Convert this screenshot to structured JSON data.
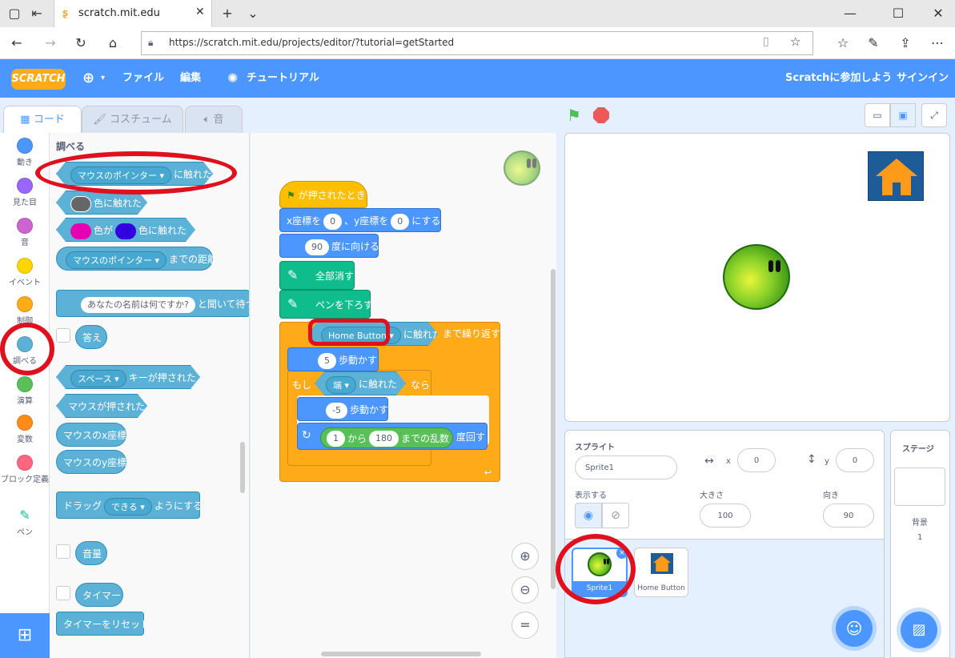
{
  "browser": {
    "tab_title": "scratch.mit.edu",
    "url": "https://scratch.mit.edu/projects/editor/?tutorial=getStarted"
  },
  "menubar": {
    "logo": "SCRATCH",
    "file": "ファイル",
    "edit": "編集",
    "tutorial": "チュートリアル",
    "join": "Scratchに参加しよう",
    "signin": "サインイン"
  },
  "tabs": {
    "code": "コード",
    "costume": "コスチューム",
    "sound": "音"
  },
  "categories": [
    {
      "label": "動き",
      "color": "#4c97ff"
    },
    {
      "label": "見た目",
      "color": "#9966ff"
    },
    {
      "label": "音",
      "color": "#cf63cf"
    },
    {
      "label": "イベント",
      "color": "#ffd500"
    },
    {
      "label": "制御",
      "color": "#ffab19"
    },
    {
      "label": "調べる",
      "color": "#5cb1d6"
    },
    {
      "label": "演算",
      "color": "#59c059"
    },
    {
      "label": "変数",
      "color": "#ff8c1a"
    },
    {
      "label": "ブロック定義",
      "color": "#ff6680"
    },
    {
      "label": "ペン",
      "color": "#0fbd8c"
    }
  ],
  "palette": {
    "heading": "調べる",
    "touching_dd": "マウスのポインター",
    "touching": "に触れた",
    "color_touch": "色に触れた",
    "color_ga": "色が",
    "color_touch2": "色に触れた",
    "distance_dd": "マウスのポインター",
    "distance": "までの距離",
    "ask_default": "あなたの名前は何ですか?",
    "ask": "と聞いて待つ",
    "answer": "答え",
    "key_dd": "スペース",
    "key": "キーが押された",
    "mouse_down": "マウスが押された",
    "mouse_x": "マウスのx座標",
    "mouse_y": "マウスのy座標",
    "drag": "ドラッグ",
    "drag_dd": "できる",
    "drag_suffix": "ようにする",
    "loudness": "音量",
    "timer": "タイマー",
    "reset_timer": "タイマーをリセット"
  },
  "script": {
    "flag": "が押されたとき",
    "goto_x": "x座標を",
    "x": "0",
    "goto_y": "、y座標を",
    "y": "0",
    "goto_end": "にする",
    "point": "90",
    "point_label": "度に向ける",
    "clear": "全部消す",
    "pendown": "ペンを下ろす",
    "touch_dd": "Home Button",
    "touch": "に触れた",
    "repeat": "まで繰り返す",
    "move": "5",
    "move_label": "歩動かす",
    "if": "もし",
    "edge_dd": "端",
    "edge_touch": "に触れた",
    "then": "なら",
    "move2": "-5",
    "move2_label": "歩動かす",
    "rnd_from": "1",
    "rnd_kara": "から",
    "rnd_to": "180",
    "rnd_label": "までの乱数",
    "turn_label": "度回す"
  },
  "sprite": {
    "label": "スプライト",
    "name": "Sprite1",
    "x_label": "x",
    "x": "0",
    "y_label": "y",
    "y": "0",
    "show": "表示する",
    "size_label": "大きさ",
    "size": "100",
    "dir_label": "向き",
    "dir": "90"
  },
  "sprites": [
    {
      "name": "Sprite1"
    },
    {
      "name": "Home Button"
    }
  ],
  "stage": {
    "label": "ステージ",
    "backdrop_label": "背景",
    "backdrop_count": "1"
  }
}
